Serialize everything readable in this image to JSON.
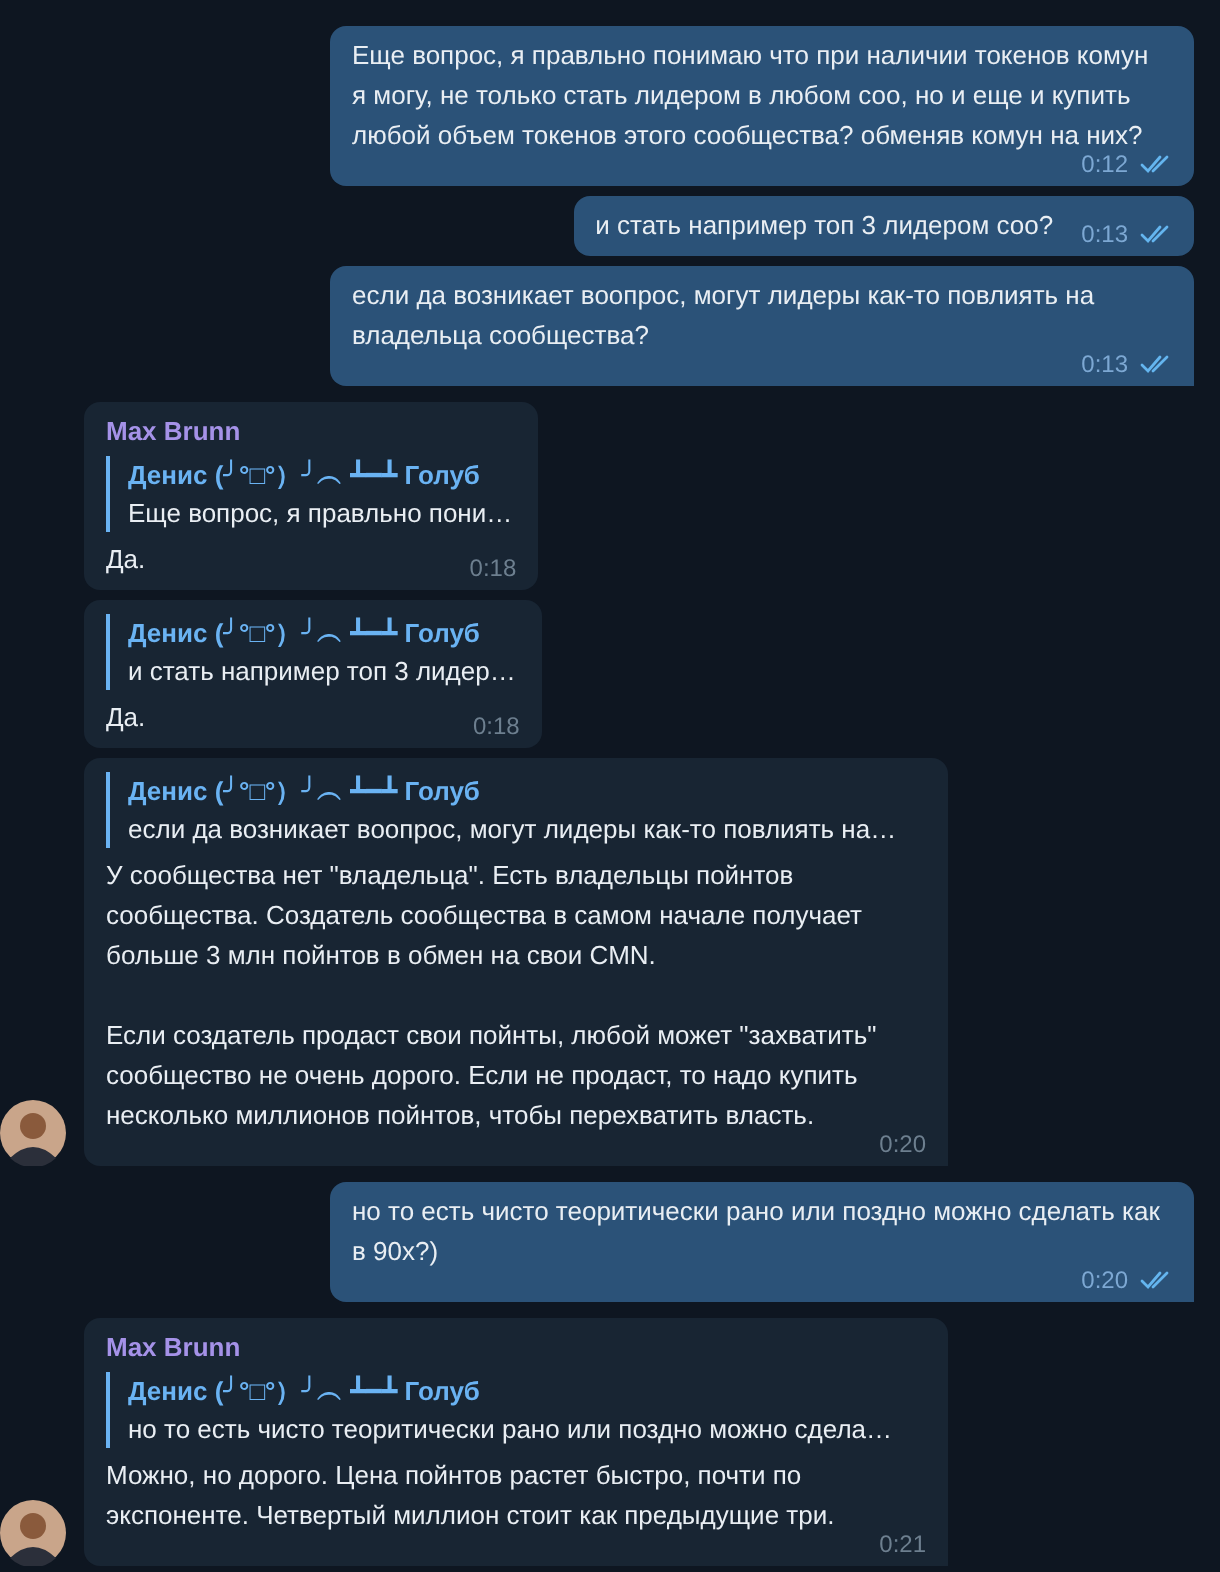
{
  "messages": [
    {
      "kind": "outgoing",
      "text": "Еще вопрос, я правльно понимаю что при наличии токенов комун я могу, не только стать лидером в любом соо, но и еще и купить любой объем токенов этого сообщества? обменяв комун на них?",
      "time": "0:12",
      "read": true,
      "tail": false
    },
    {
      "kind": "outgoing",
      "text": "и стать например топ 3 лидером соо?",
      "time": "0:13",
      "read": true,
      "tail": false
    },
    {
      "kind": "outgoing",
      "text": "если да возникает воопрос, могут лидеры как-то повлиять на владельца сообщества?",
      "time": "0:13",
      "read": true,
      "tail": true
    },
    {
      "kind": "incoming",
      "sender": "Max Brunn",
      "reply": {
        "name": "Денис (╯°□°）╯︵ ┻━┻ Голуб",
        "text": "Еще вопрос, я правльно пони…"
      },
      "text": "Да.",
      "time": "0:18",
      "avatar": false
    },
    {
      "kind": "incoming",
      "reply": {
        "name": "Денис (╯°□°）╯︵ ┻━┻ Голуб",
        "text": "и стать например топ 3 лидер…"
      },
      "text": "Да.",
      "time": "0:18",
      "avatar": false
    },
    {
      "kind": "incoming",
      "reply": {
        "name": "Денис (╯°□°）╯︵ ┻━┻ Голуб",
        "text": "если да возникает воопрос, могут лидеры как-то повлиять на…"
      },
      "text": "У сообщества нет \"владельца\". Есть владельцы пойнтов сообщества. Создатель сообщества в самом начале получает больше 3 млн пойнтов в обмен на свои CMN.\n\nЕсли создатель продаст свои пойнты, любой может \"захватить\" сообщество не очень дорого. Если не продаст, то надо купить несколько миллионов пойнтов, чтобы перехватить власть.",
      "time": "0:20",
      "avatar": true
    },
    {
      "kind": "outgoing",
      "text": "но то есть чисто теоритически рано или поздно можно сделать как в 90х?)",
      "time": "0:20",
      "read": true,
      "tail": true
    },
    {
      "kind": "incoming",
      "sender": "Max Brunn",
      "reply": {
        "name": "Денис (╯°□°）╯︵ ┻━┻ Голуб",
        "text": "но то есть чисто теоритически рано или поздно можно сдела…"
      },
      "text": "Можно, но дорого. Цена пойнтов растет быстро, почти по экспоненте. Четвертый миллион стоит как предыдущие три.",
      "time": "0:21",
      "avatar": true
    }
  ]
}
